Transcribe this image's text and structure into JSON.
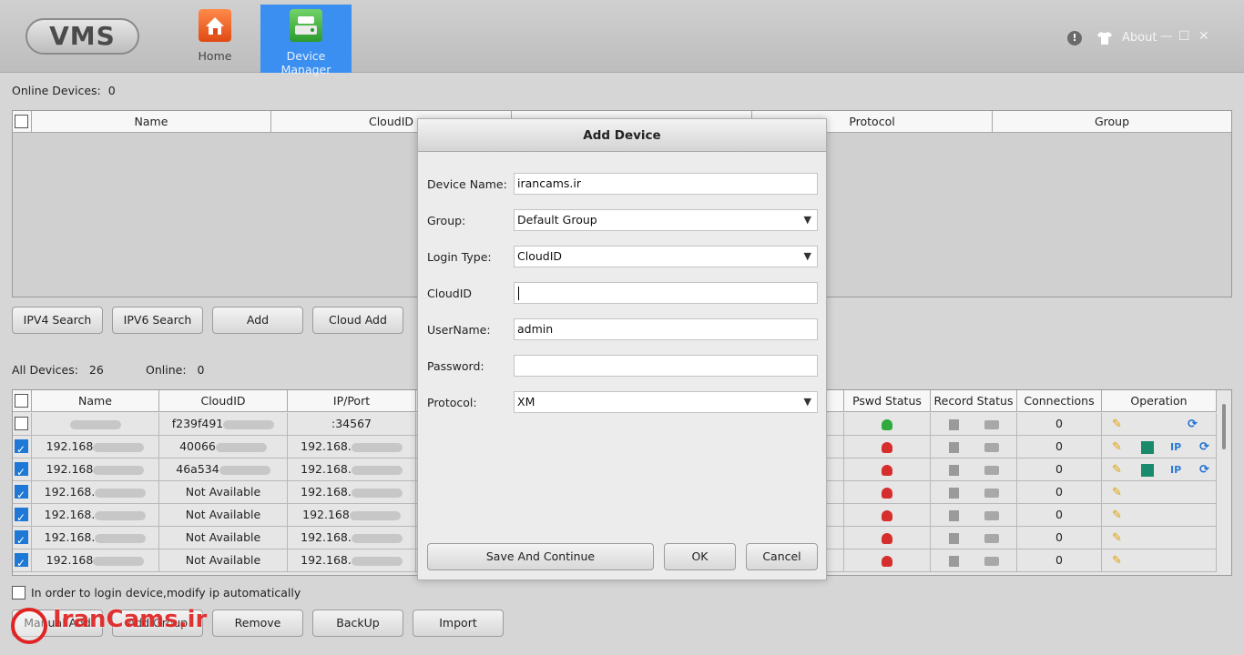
{
  "app": {
    "logo": "VMS"
  },
  "nav": {
    "home": "Home",
    "device_manager": "Device Manager"
  },
  "topright": {
    "info_icon": "!",
    "about": "About",
    "minimize": "—",
    "maximize": "☐",
    "close": "✕"
  },
  "online": {
    "label": "Online Devices:",
    "count": "0",
    "columns": [
      "Name",
      "CloudID",
      "",
      "Protocol",
      "Group"
    ]
  },
  "search_buttons": {
    "ipv4": "IPV4 Search",
    "ipv6": "IPV6 Search",
    "add": "Add",
    "cloud_add": "Cloud Add"
  },
  "all": {
    "label": "All Devices:",
    "count": "26",
    "online_label": "Online:",
    "online_count": "0"
  },
  "devices": {
    "columns": [
      "Name",
      "CloudID",
      "IP/Port",
      "Pswd Status",
      "Record Status",
      "Connections",
      "Operation"
    ],
    "rows": [
      {
        "checked": false,
        "name": "",
        "cloudid": "f239f491",
        "ip": ":34567",
        "pswd": "green",
        "connections": "0",
        "ops": [
          "pencil",
          "refresh"
        ]
      },
      {
        "checked": true,
        "name": "192.168",
        "cloudid": "40066",
        "ip": "192.168.",
        "pswd": "red",
        "connections": "0",
        "ops": [
          "pencil",
          "qr",
          "ip",
          "refresh"
        ]
      },
      {
        "checked": true,
        "name": "192.168",
        "cloudid": "46a534",
        "ip": "192.168.",
        "pswd": "red",
        "connections": "0",
        "ops": [
          "pencil",
          "qr",
          "ip",
          "refresh"
        ]
      },
      {
        "checked": true,
        "name": "192.168.",
        "cloudid": "Not Available",
        "ip": "192.168.",
        "pswd": "red",
        "connections": "0",
        "ops": [
          "pencil"
        ]
      },
      {
        "checked": true,
        "name": "192.168.",
        "cloudid": "Not Available",
        "ip": "192.168",
        "pswd": "red",
        "connections": "0",
        "ops": [
          "pencil"
        ]
      },
      {
        "checked": true,
        "name": "192.168.",
        "cloudid": "Not Available",
        "ip": "192.168.",
        "pswd": "red",
        "connections": "0",
        "ops": [
          "pencil"
        ]
      },
      {
        "checked": true,
        "name": "192.168",
        "cloudid": "Not Available",
        "ip": "192.168.",
        "pswd": "red",
        "connections": "0",
        "ops": [
          "pencil"
        ]
      }
    ]
  },
  "auto_ip": {
    "label": "In order to login device,modify ip automatically",
    "checked": false
  },
  "bottom_buttons": {
    "manual_add": "Manual Add",
    "add_group": "Add Group",
    "remove": "Remove",
    "backup": "BackUp",
    "import": "Import"
  },
  "watermark": "IranCams.ir",
  "dialog": {
    "title": "Add Device",
    "fields": {
      "device_name": {
        "label": "Device Name:",
        "value": "irancams.ir"
      },
      "group": {
        "label": "Group:",
        "value": "Default Group"
      },
      "login_type": {
        "label": "Login Type:",
        "value": "CloudID"
      },
      "cloudid": {
        "label": "CloudID",
        "value": ""
      },
      "username": {
        "label": "UserName:",
        "value": "admin"
      },
      "password": {
        "label": "Password:",
        "value": ""
      },
      "protocol": {
        "label": "Protocol:",
        "value": "XM"
      }
    },
    "buttons": {
      "save_continue": "Save And Continue",
      "ok": "OK",
      "cancel": "Cancel"
    }
  }
}
